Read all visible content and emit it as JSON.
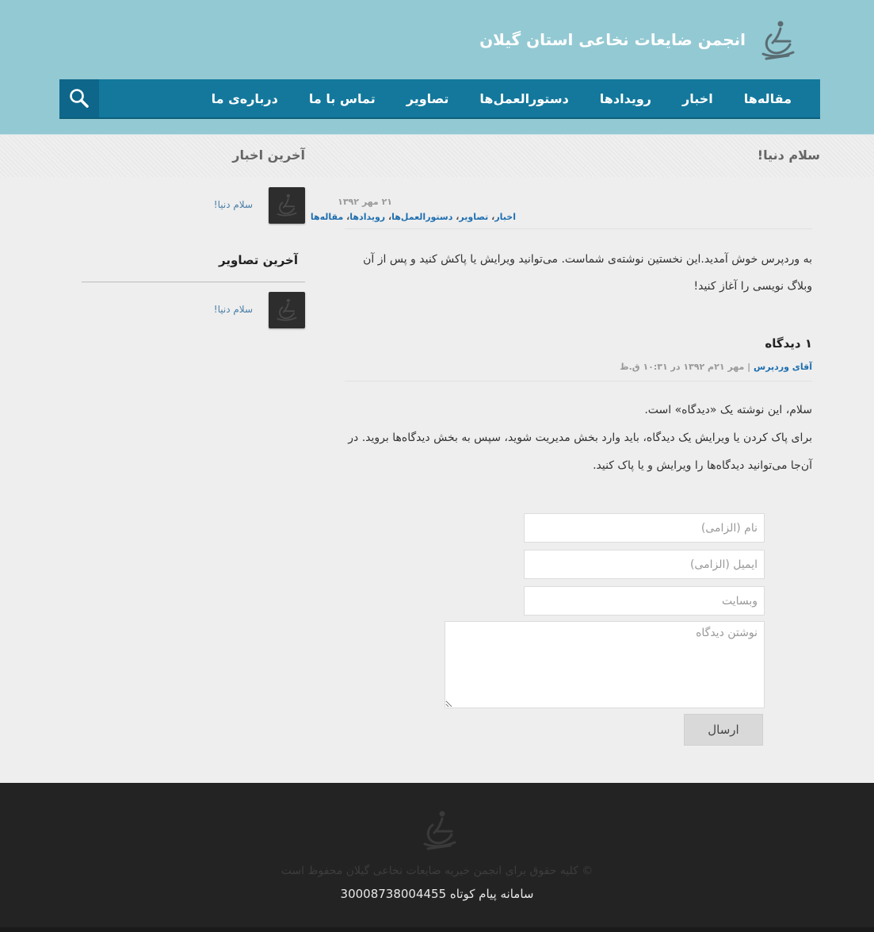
{
  "header": {
    "site_title": "انجمن ضایعات نخاعی استان گیلان",
    "logo_icon": "wheelchair-logo-icon"
  },
  "nav": {
    "items": [
      "مقاله‌ها",
      "اخبار",
      "رویدادها",
      "دستورالعمل‌ها",
      "تصاویر",
      "تماس با ما",
      "درباره‌ی ما"
    ],
    "search_icon": "search-icon"
  },
  "main": {
    "post_title": "سلام دنیا!",
    "date": "۲۱ مهر ۱۳۹۲",
    "categories": [
      "اخبار",
      "تصاویر",
      "دستورالعمل‌ها",
      "رویدادها",
      "مقاله‌ها"
    ],
    "body": "به وردپرس خوش آمدید.این نخستین نوشته‌ی شماست. می‌توانید ویرایش یا پاکش کنید و پس از آن وبلاگ نویسی را آغاز کنید!",
    "comments_title": "۱ دیدگاه",
    "comment": {
      "author": "آقای وردپرس",
      "separator": "|",
      "date": "مهر ۲۱م ۱۳۹۲ در ۱۰:۳۱ ق.ظ",
      "line1": "سلام، این نوشته یک «دیدگاه» است.",
      "line2": "برای پاک کردن یا ویرایش یک دیدگاه، باید وارد بخش مدیریت شوید، سپس به بخش دیدگاه‌ها بروید. در آن‌جا می‌توانید دیدگاه‌ها را ویرایش و یا پاک کنید."
    }
  },
  "form": {
    "name_placeholder": "نام (الزامی)",
    "email_placeholder": "ایمیل (الزامی)",
    "website_placeholder": "وبسایت",
    "comment_placeholder": "نوشتن دیدگاه",
    "submit_label": "ارسال"
  },
  "sidebar": {
    "latest_news_title": "آخرین اخبار",
    "latest_news_link": "سلام دنیا!",
    "latest_images_title": "آخرین تصاویر",
    "latest_images_link": "سلام دنیا!"
  },
  "footer": {
    "copyright": "© کلیه حقوق برای انجمن خیریه ضایعات نخاعی گیلان محفوظ است",
    "sms": "سامانه پیام کوتاه 30008738004455"
  },
  "colors": {
    "header_bg": "#93c9d3",
    "nav_bg": "#13789c",
    "link": "#1f6fb0",
    "footer_bg": "#232323"
  }
}
